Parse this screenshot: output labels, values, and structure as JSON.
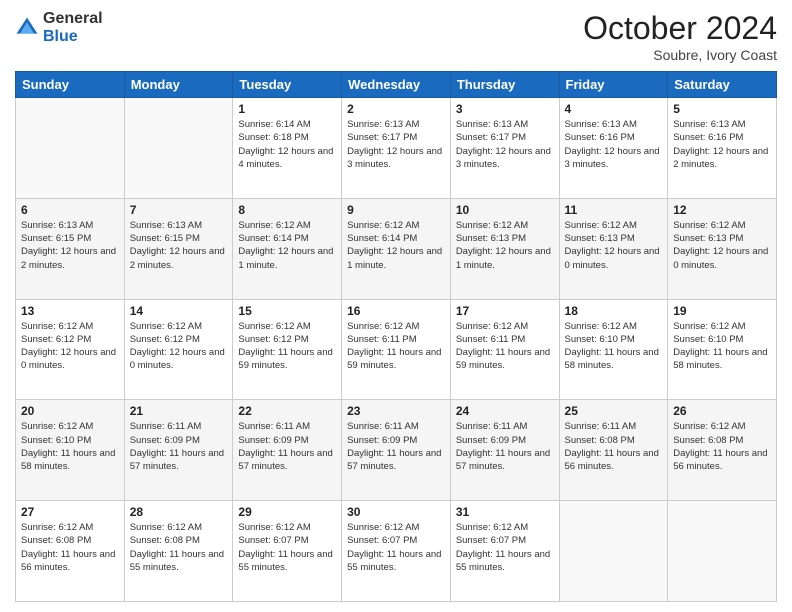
{
  "header": {
    "logo_line1": "General",
    "logo_line2": "Blue",
    "month": "October 2024",
    "location": "Soubre, Ivory Coast"
  },
  "weekdays": [
    "Sunday",
    "Monday",
    "Tuesday",
    "Wednesday",
    "Thursday",
    "Friday",
    "Saturday"
  ],
  "weeks": [
    [
      {
        "day": "",
        "detail": ""
      },
      {
        "day": "",
        "detail": ""
      },
      {
        "day": "1",
        "detail": "Sunrise: 6:14 AM\nSunset: 6:18 PM\nDaylight: 12 hours and 4 minutes."
      },
      {
        "day": "2",
        "detail": "Sunrise: 6:13 AM\nSunset: 6:17 PM\nDaylight: 12 hours and 3 minutes."
      },
      {
        "day": "3",
        "detail": "Sunrise: 6:13 AM\nSunset: 6:17 PM\nDaylight: 12 hours and 3 minutes."
      },
      {
        "day": "4",
        "detail": "Sunrise: 6:13 AM\nSunset: 6:16 PM\nDaylight: 12 hours and 3 minutes."
      },
      {
        "day": "5",
        "detail": "Sunrise: 6:13 AM\nSunset: 6:16 PM\nDaylight: 12 hours and 2 minutes."
      }
    ],
    [
      {
        "day": "6",
        "detail": "Sunrise: 6:13 AM\nSunset: 6:15 PM\nDaylight: 12 hours and 2 minutes."
      },
      {
        "day": "7",
        "detail": "Sunrise: 6:13 AM\nSunset: 6:15 PM\nDaylight: 12 hours and 2 minutes."
      },
      {
        "day": "8",
        "detail": "Sunrise: 6:12 AM\nSunset: 6:14 PM\nDaylight: 12 hours and 1 minute."
      },
      {
        "day": "9",
        "detail": "Sunrise: 6:12 AM\nSunset: 6:14 PM\nDaylight: 12 hours and 1 minute."
      },
      {
        "day": "10",
        "detail": "Sunrise: 6:12 AM\nSunset: 6:13 PM\nDaylight: 12 hours and 1 minute."
      },
      {
        "day": "11",
        "detail": "Sunrise: 6:12 AM\nSunset: 6:13 PM\nDaylight: 12 hours and 0 minutes."
      },
      {
        "day": "12",
        "detail": "Sunrise: 6:12 AM\nSunset: 6:13 PM\nDaylight: 12 hours and 0 minutes."
      }
    ],
    [
      {
        "day": "13",
        "detail": "Sunrise: 6:12 AM\nSunset: 6:12 PM\nDaylight: 12 hours and 0 minutes."
      },
      {
        "day": "14",
        "detail": "Sunrise: 6:12 AM\nSunset: 6:12 PM\nDaylight: 12 hours and 0 minutes."
      },
      {
        "day": "15",
        "detail": "Sunrise: 6:12 AM\nSunset: 6:12 PM\nDaylight: 11 hours and 59 minutes."
      },
      {
        "day": "16",
        "detail": "Sunrise: 6:12 AM\nSunset: 6:11 PM\nDaylight: 11 hours and 59 minutes."
      },
      {
        "day": "17",
        "detail": "Sunrise: 6:12 AM\nSunset: 6:11 PM\nDaylight: 11 hours and 59 minutes."
      },
      {
        "day": "18",
        "detail": "Sunrise: 6:12 AM\nSunset: 6:10 PM\nDaylight: 11 hours and 58 minutes."
      },
      {
        "day": "19",
        "detail": "Sunrise: 6:12 AM\nSunset: 6:10 PM\nDaylight: 11 hours and 58 minutes."
      }
    ],
    [
      {
        "day": "20",
        "detail": "Sunrise: 6:12 AM\nSunset: 6:10 PM\nDaylight: 11 hours and 58 minutes."
      },
      {
        "day": "21",
        "detail": "Sunrise: 6:11 AM\nSunset: 6:09 PM\nDaylight: 11 hours and 57 minutes."
      },
      {
        "day": "22",
        "detail": "Sunrise: 6:11 AM\nSunset: 6:09 PM\nDaylight: 11 hours and 57 minutes."
      },
      {
        "day": "23",
        "detail": "Sunrise: 6:11 AM\nSunset: 6:09 PM\nDaylight: 11 hours and 57 minutes."
      },
      {
        "day": "24",
        "detail": "Sunrise: 6:11 AM\nSunset: 6:09 PM\nDaylight: 11 hours and 57 minutes."
      },
      {
        "day": "25",
        "detail": "Sunrise: 6:11 AM\nSunset: 6:08 PM\nDaylight: 11 hours and 56 minutes."
      },
      {
        "day": "26",
        "detail": "Sunrise: 6:12 AM\nSunset: 6:08 PM\nDaylight: 11 hours and 56 minutes."
      }
    ],
    [
      {
        "day": "27",
        "detail": "Sunrise: 6:12 AM\nSunset: 6:08 PM\nDaylight: 11 hours and 56 minutes."
      },
      {
        "day": "28",
        "detail": "Sunrise: 6:12 AM\nSunset: 6:08 PM\nDaylight: 11 hours and 55 minutes."
      },
      {
        "day": "29",
        "detail": "Sunrise: 6:12 AM\nSunset: 6:07 PM\nDaylight: 11 hours and 55 minutes."
      },
      {
        "day": "30",
        "detail": "Sunrise: 6:12 AM\nSunset: 6:07 PM\nDaylight: 11 hours and 55 minutes."
      },
      {
        "day": "31",
        "detail": "Sunrise: 6:12 AM\nSunset: 6:07 PM\nDaylight: 11 hours and 55 minutes."
      },
      {
        "day": "",
        "detail": ""
      },
      {
        "day": "",
        "detail": ""
      }
    ]
  ]
}
